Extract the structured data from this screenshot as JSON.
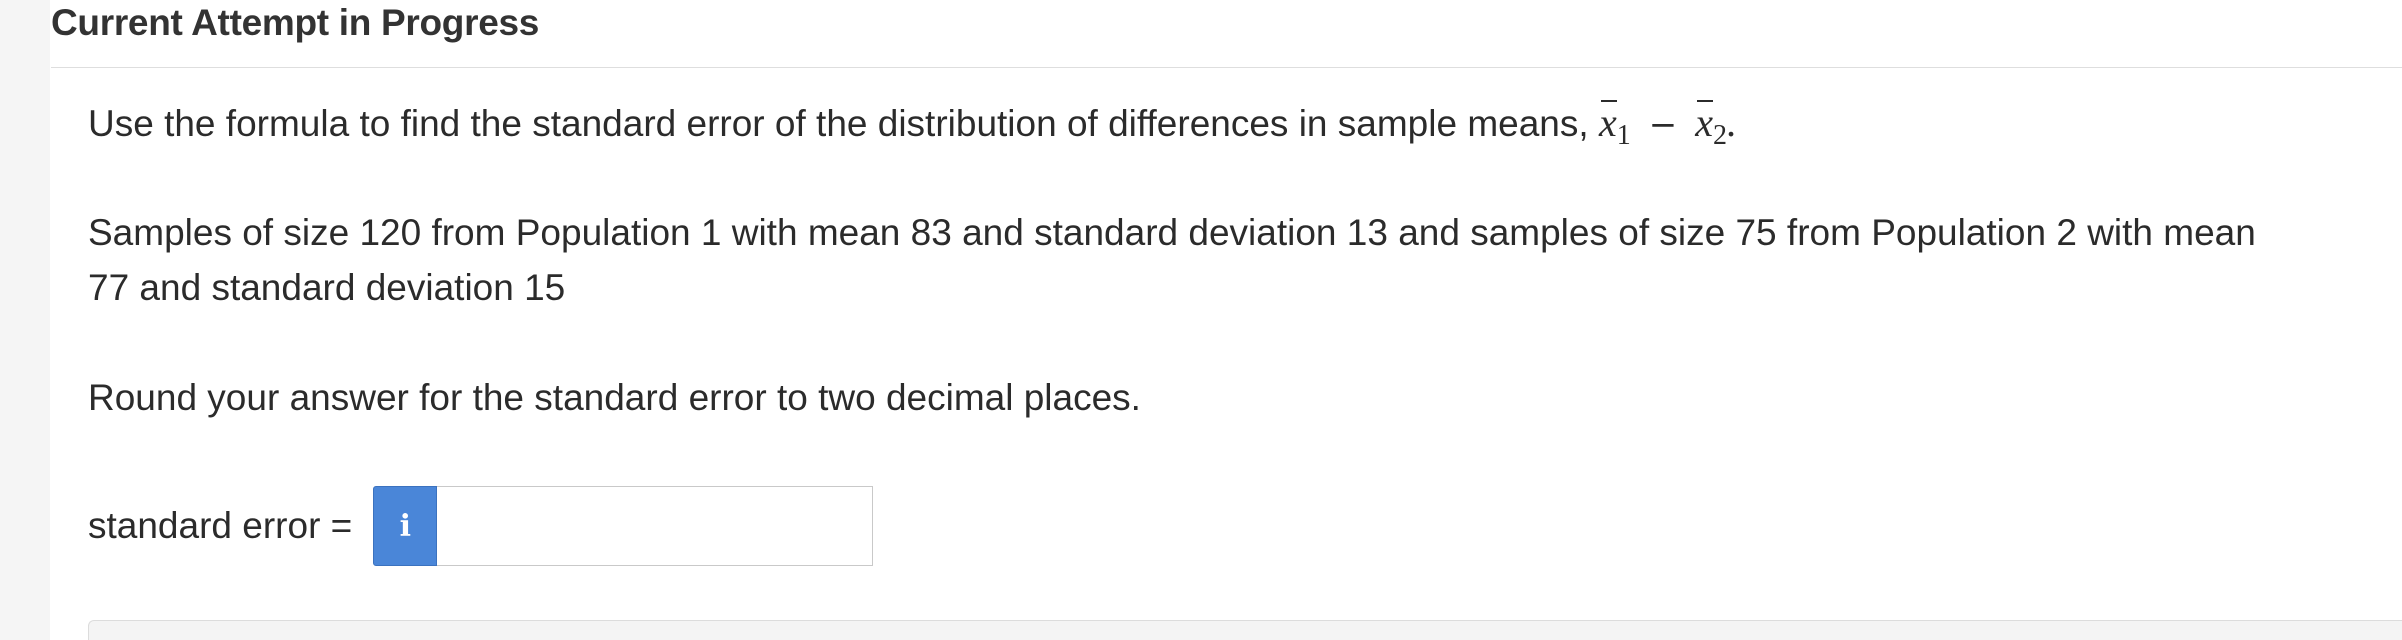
{
  "header": {
    "title": "Current Attempt in Progress"
  },
  "question": {
    "intro_text": "Use the formula to find the standard error of the distribution of differences in sample means, ",
    "math": {
      "var1": "x",
      "sub1": "1",
      "minus": "−",
      "var2": "x",
      "sub2": "2",
      "end": "."
    },
    "samples_line1": "Samples of size 120 from Population 1 with mean 83 and standard deviation 13 and samples of size 75 from Population 2 with mean",
    "samples_line2": "77 and standard deviation 15",
    "rounding_instruction": "Round your answer for the standard error to two decimal places."
  },
  "answer": {
    "label": "standard error =",
    "info_icon_glyph": "i",
    "input_value": ""
  },
  "colors": {
    "info_button": "#4a86d8",
    "text": "#2b2b2b",
    "gutter": "#f5f5f5"
  }
}
